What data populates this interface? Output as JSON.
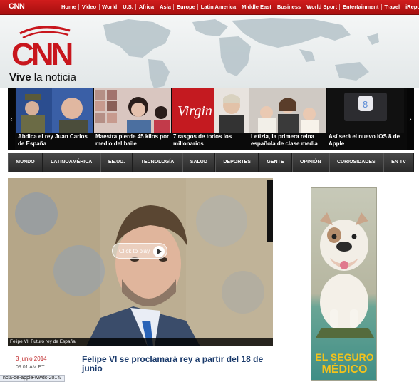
{
  "topnav": {
    "logo": "CNN",
    "links": [
      "Home",
      "Video",
      "World",
      "U.S.",
      "Africa",
      "Asia",
      "Europe",
      "Latin America",
      "Middle East",
      "Business",
      "World Sport",
      "Entertainment",
      "Travel",
      "iReport"
    ]
  },
  "header": {
    "logo_text": "CNN",
    "tagline_bold": "Vive",
    "tagline_rest": " la noticia"
  },
  "carousel": {
    "prev": "‹",
    "next": "›",
    "items": [
      {
        "caption": "Abdica el rey Juan Carlos de España"
      },
      {
        "caption": "Maestra pierde 45 kilos por medio del baile"
      },
      {
        "caption": "7 rasgos de todos los millonarios"
      },
      {
        "caption": "Letizia, la primera reina española de clase media"
      },
      {
        "caption": "Así será el nuevo iOS 8 de Apple"
      }
    ]
  },
  "sections": [
    "MUNDO",
    "LATINOAMÉRICA",
    "EE.UU.",
    "TECNOLOGÍA",
    "SALUD",
    "DEPORTES",
    "GENTE",
    "OPINIÓN",
    "CURIOSIDADES",
    "EN TV"
  ],
  "video": {
    "play_label": "Click to play",
    "caption": "Felipe VI: Futuro rey de España"
  },
  "story": {
    "date": "3 junio 2014",
    "time": "09:01 AM ET",
    "title": "Felipe VI se proclamará rey a partir del 18 de junio"
  },
  "status_url": "ncia-de-apple-wwdc-2014/",
  "ad": {
    "line1": "EL SEGURO",
    "line2": "MÉDICO"
  },
  "colors": {
    "cnn_red": "#c8161d",
    "nav_dark": "#333333",
    "headline_blue": "#1a3a6b",
    "ad_yellow": "#f3c21c"
  }
}
